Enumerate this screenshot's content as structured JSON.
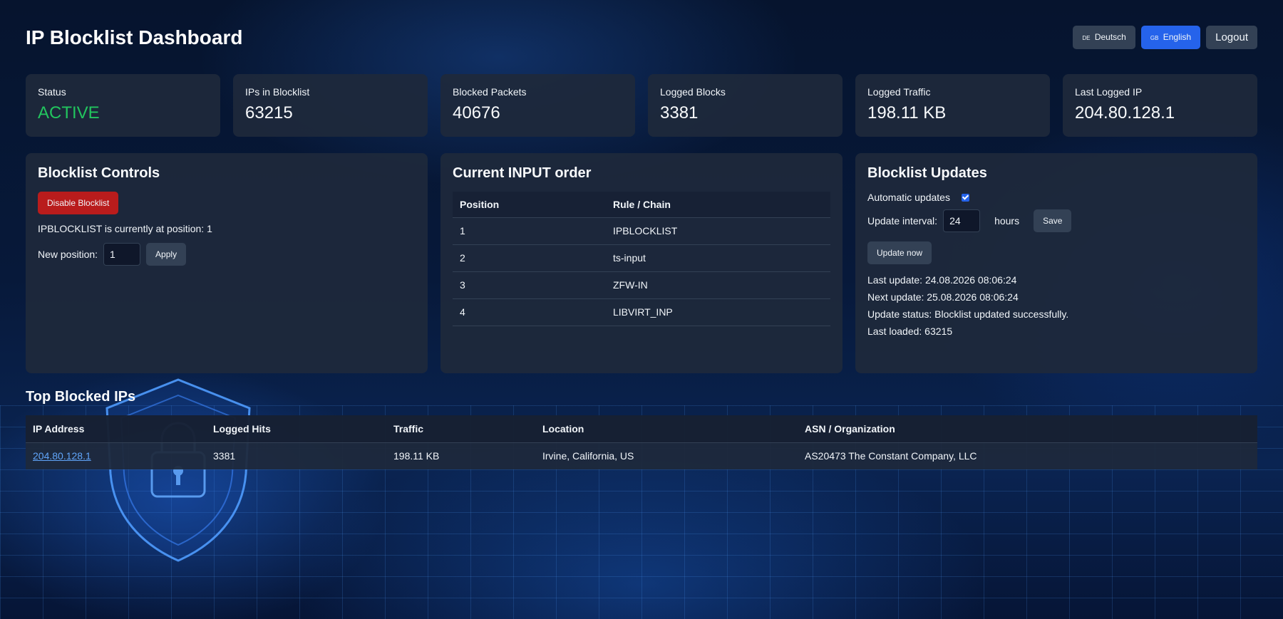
{
  "header": {
    "title": "IP Blocklist Dashboard",
    "lang_de": {
      "flag": "DE",
      "label": "Deutsch"
    },
    "lang_en": {
      "flag": "GB",
      "label": "English"
    },
    "logout": "Logout"
  },
  "stats": [
    {
      "label": "Status",
      "value": "ACTIVE"
    },
    {
      "label": "IPs in Blocklist",
      "value": "63215"
    },
    {
      "label": "Blocked Packets",
      "value": "40676"
    },
    {
      "label": "Logged Blocks",
      "value": "3381"
    },
    {
      "label": "Logged Traffic",
      "value": "198.11 KB"
    },
    {
      "label": "Last Logged IP",
      "value": "204.80.128.1"
    }
  ],
  "controls": {
    "title": "Blocklist Controls",
    "disable_button": "Disable Blocklist",
    "position_text": "IPBLOCKLIST is currently at position: 1",
    "new_position_label": "New position:",
    "new_position_value": "1",
    "apply_button": "Apply"
  },
  "input_order": {
    "title": "Current INPUT order",
    "headers": [
      "Position",
      "Rule / Chain"
    ],
    "rows": [
      [
        "1",
        "IPBLOCKLIST"
      ],
      [
        "2",
        "ts-input"
      ],
      [
        "3",
        "ZFW-IN"
      ],
      [
        "4",
        "LIBVIRT_INP"
      ]
    ]
  },
  "updates": {
    "title": "Blocklist Updates",
    "auto_label": "Automatic updates",
    "auto_checked": true,
    "interval_label": "Update interval:",
    "interval_value": "24",
    "interval_unit": "hours",
    "save_button": "Save",
    "update_now_button": "Update now",
    "last_update": "Last update: 24.08.2026 08:06:24",
    "next_update": "Next update: 25.08.2026 08:06:24",
    "status": "Update status: Blocklist updated successfully.",
    "last_loaded": "Last loaded: 63215"
  },
  "top_blocked": {
    "title": "Top Blocked IPs",
    "headers": [
      "IP Address",
      "Logged Hits",
      "Traffic",
      "Location",
      "ASN / Organization"
    ],
    "rows": [
      [
        "204.80.128.1",
        "3381",
        "198.11 KB",
        "Irvine, California, US",
        "AS20473 The Constant Company, LLC"
      ]
    ]
  },
  "colors": {
    "accent": "#2563eb",
    "active_status": "#22c55e",
    "danger": "#b91c1c",
    "link": "#60a5fa"
  }
}
